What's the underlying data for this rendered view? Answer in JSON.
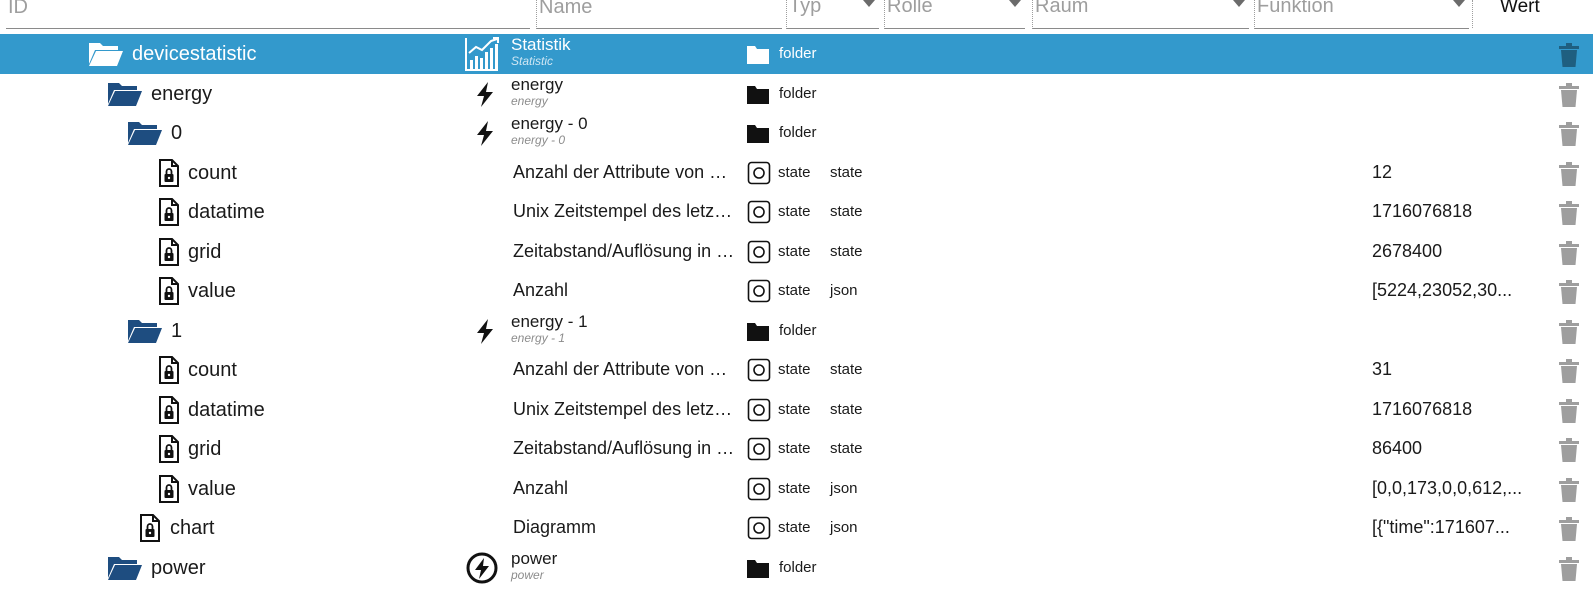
{
  "filters": {
    "id_placeholder": "ID",
    "name_placeholder": "Name",
    "type_label": "Typ",
    "role_label": "Rolle",
    "room_label": "Raum",
    "function_label": "Funktion",
    "value_header": "Wert"
  },
  "colors": {
    "selected_bg": "#3399cc",
    "folder_open": "#1e4d80",
    "trash": "#9e9e9e"
  },
  "rows": [
    {
      "id": "devicestatistic",
      "name": "Statistik",
      "name_sub": "Statistic",
      "name_icon": "statistics-chart-icon",
      "tree_icon": "folder-open-icon",
      "type": "folder",
      "selected": true
    },
    {
      "id": "energy",
      "name": "energy",
      "name_sub": "energy",
      "name_icon": "lightning-icon",
      "tree_icon": "folder-open-icon",
      "type": "folder"
    },
    {
      "id": "0",
      "name": "energy - 0",
      "name_sub": "energy - 0",
      "name_icon": "lightning-icon",
      "tree_icon": "folder-open-icon",
      "type": "folder"
    },
    {
      "id": "count",
      "desc": "Anzahl der Attribute von Da...",
      "type": "state",
      "role": "state",
      "value": "12",
      "tree_icon": "file-lock-icon"
    },
    {
      "id": "datatime",
      "desc": "Unix Zeitstempel des letzte...",
      "type": "state",
      "role": "state",
      "value": "1716076818",
      "tree_icon": "file-lock-icon"
    },
    {
      "id": "grid",
      "desc": "Zeitabstand/Auflösung in S...",
      "type": "state",
      "role": "state",
      "value": "2678400",
      "tree_icon": "file-lock-icon"
    },
    {
      "id": "value",
      "desc": "Anzahl",
      "type": "state",
      "role": "json",
      "value": "[5224,23052,30...",
      "tree_icon": "file-lock-icon"
    },
    {
      "id": "1",
      "name": "energy - 1",
      "name_sub": "energy - 1",
      "name_icon": "lightning-icon",
      "tree_icon": "folder-open-icon",
      "type": "folder"
    },
    {
      "id": "count",
      "desc": "Anzahl der Attribute von Da...",
      "type": "state",
      "role": "state",
      "value": "31",
      "tree_icon": "file-lock-icon"
    },
    {
      "id": "datatime",
      "desc": "Unix Zeitstempel des letzte...",
      "type": "state",
      "role": "state",
      "value": "1716076818",
      "tree_icon": "file-lock-icon"
    },
    {
      "id": "grid",
      "desc": "Zeitabstand/Auflösung in S...",
      "type": "state",
      "role": "state",
      "value": "86400",
      "tree_icon": "file-lock-icon"
    },
    {
      "id": "value",
      "desc": "Anzahl",
      "type": "state",
      "role": "json",
      "value": "[0,0,173,0,0,612,...",
      "tree_icon": "file-lock-icon"
    },
    {
      "id": "chart",
      "desc": "Diagramm",
      "type": "state",
      "role": "json",
      "value": "[{\"time\":171607...",
      "tree_icon": "file-lock-icon"
    },
    {
      "id": "power",
      "name": "power",
      "name_sub": "power",
      "name_icon": "lightning-circle-icon",
      "tree_icon": "folder-open-icon",
      "type": "folder"
    }
  ]
}
